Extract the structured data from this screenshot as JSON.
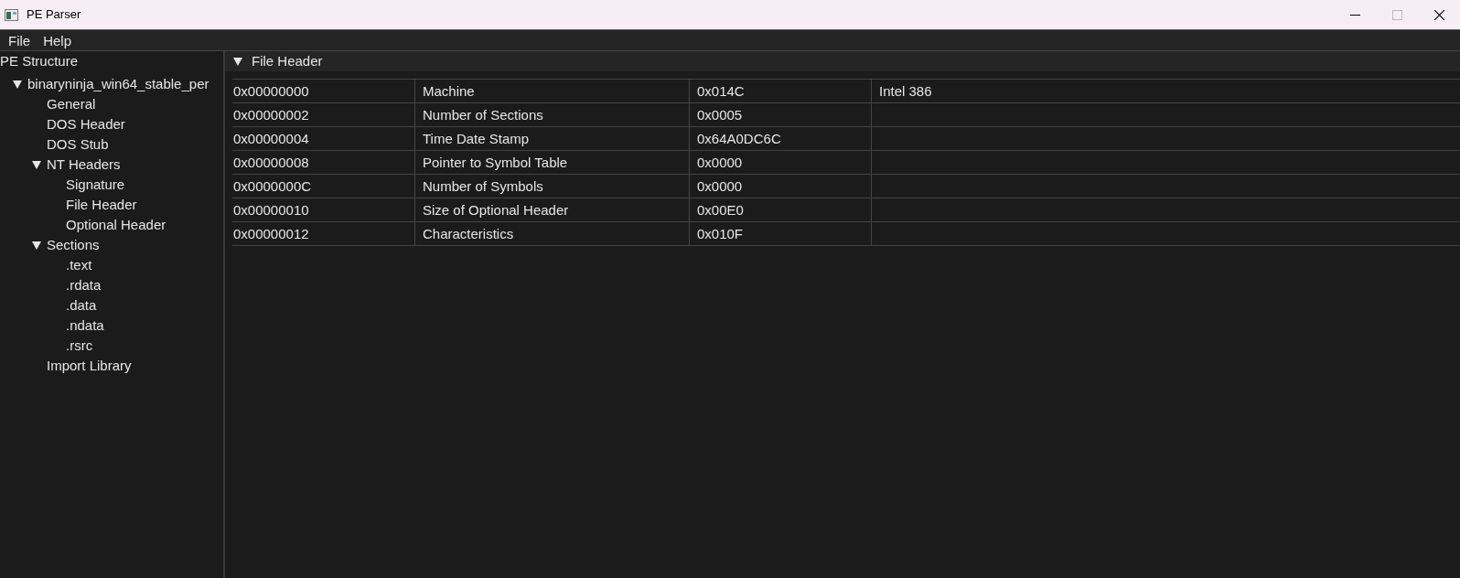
{
  "window": {
    "title": "PE Parser"
  },
  "menu": [
    "File",
    "Help"
  ],
  "sidebar": {
    "title": "PE Structure",
    "tree": [
      {
        "label": "binaryninja_win64_stable_per",
        "expanded": true,
        "children": [
          {
            "label": "General"
          },
          {
            "label": "DOS Header"
          },
          {
            "label": "DOS Stub"
          },
          {
            "label": "NT Headers",
            "expanded": true,
            "children": [
              {
                "label": "Signature"
              },
              {
                "label": "File Header"
              },
              {
                "label": "Optional Header"
              }
            ]
          },
          {
            "label": "Sections",
            "expanded": true,
            "children": [
              {
                "label": ".text"
              },
              {
                "label": ".rdata"
              },
              {
                "label": ".data"
              },
              {
                "label": ".ndata"
              },
              {
                "label": ".rsrc"
              }
            ]
          },
          {
            "label": "Import Library"
          }
        ]
      }
    ]
  },
  "section": {
    "title": "File Header",
    "expanded": true,
    "rows": [
      [
        "0x00000000",
        "Machine",
        "0x014C",
        "Intel 386"
      ],
      [
        "0x00000002",
        "Number of Sections",
        "0x0005",
        ""
      ],
      [
        "0x00000004",
        "Time Date Stamp",
        "0x64A0DC6C",
        ""
      ],
      [
        "0x00000008",
        "Pointer to Symbol Table",
        "0x0000",
        ""
      ],
      [
        "0x0000000C",
        "Number of Symbols",
        "0x0000",
        ""
      ],
      [
        "0x00000010",
        "Size of Optional Header",
        "0x00E0",
        ""
      ],
      [
        "0x00000012",
        "Characteristics",
        "0x010F",
        ""
      ]
    ]
  }
}
